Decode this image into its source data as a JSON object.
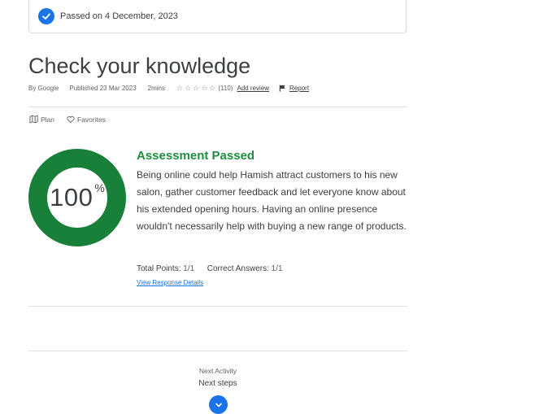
{
  "banner": {
    "text": "Passed on 4 December, 2023"
  },
  "title": "Check your knowledge",
  "meta": {
    "author": "By Google",
    "published": "Published 23 Mar 2023",
    "duration": "2mins",
    "rating_count": "(110)",
    "add_review": "Add review",
    "report": "Report",
    "rating_stars": 0
  },
  "actions": {
    "plan": "Plan",
    "favorites": "Favorites"
  },
  "result": {
    "score": "100",
    "score_unit": "%",
    "score_fraction": 1.0,
    "title": "Assessment Passed",
    "body": "Being online could help Hamish attract customers to his new salon, gather customer feedback and let everyone know about his extended opening hours. Having an online presence wouldn't necessarily help with buying a new range of products.",
    "total_points_label": "Total Points:",
    "total_points_value": "1/1",
    "correct_answers_label": "Correct Answers:",
    "correct_answers_value": "1/1",
    "details_link": "View Response Details"
  },
  "next": {
    "label": "Next Activity",
    "title": "Next steps"
  },
  "colors": {
    "accent": "#1a73e8",
    "success": "#1e8e3e",
    "ring": "#188038"
  }
}
